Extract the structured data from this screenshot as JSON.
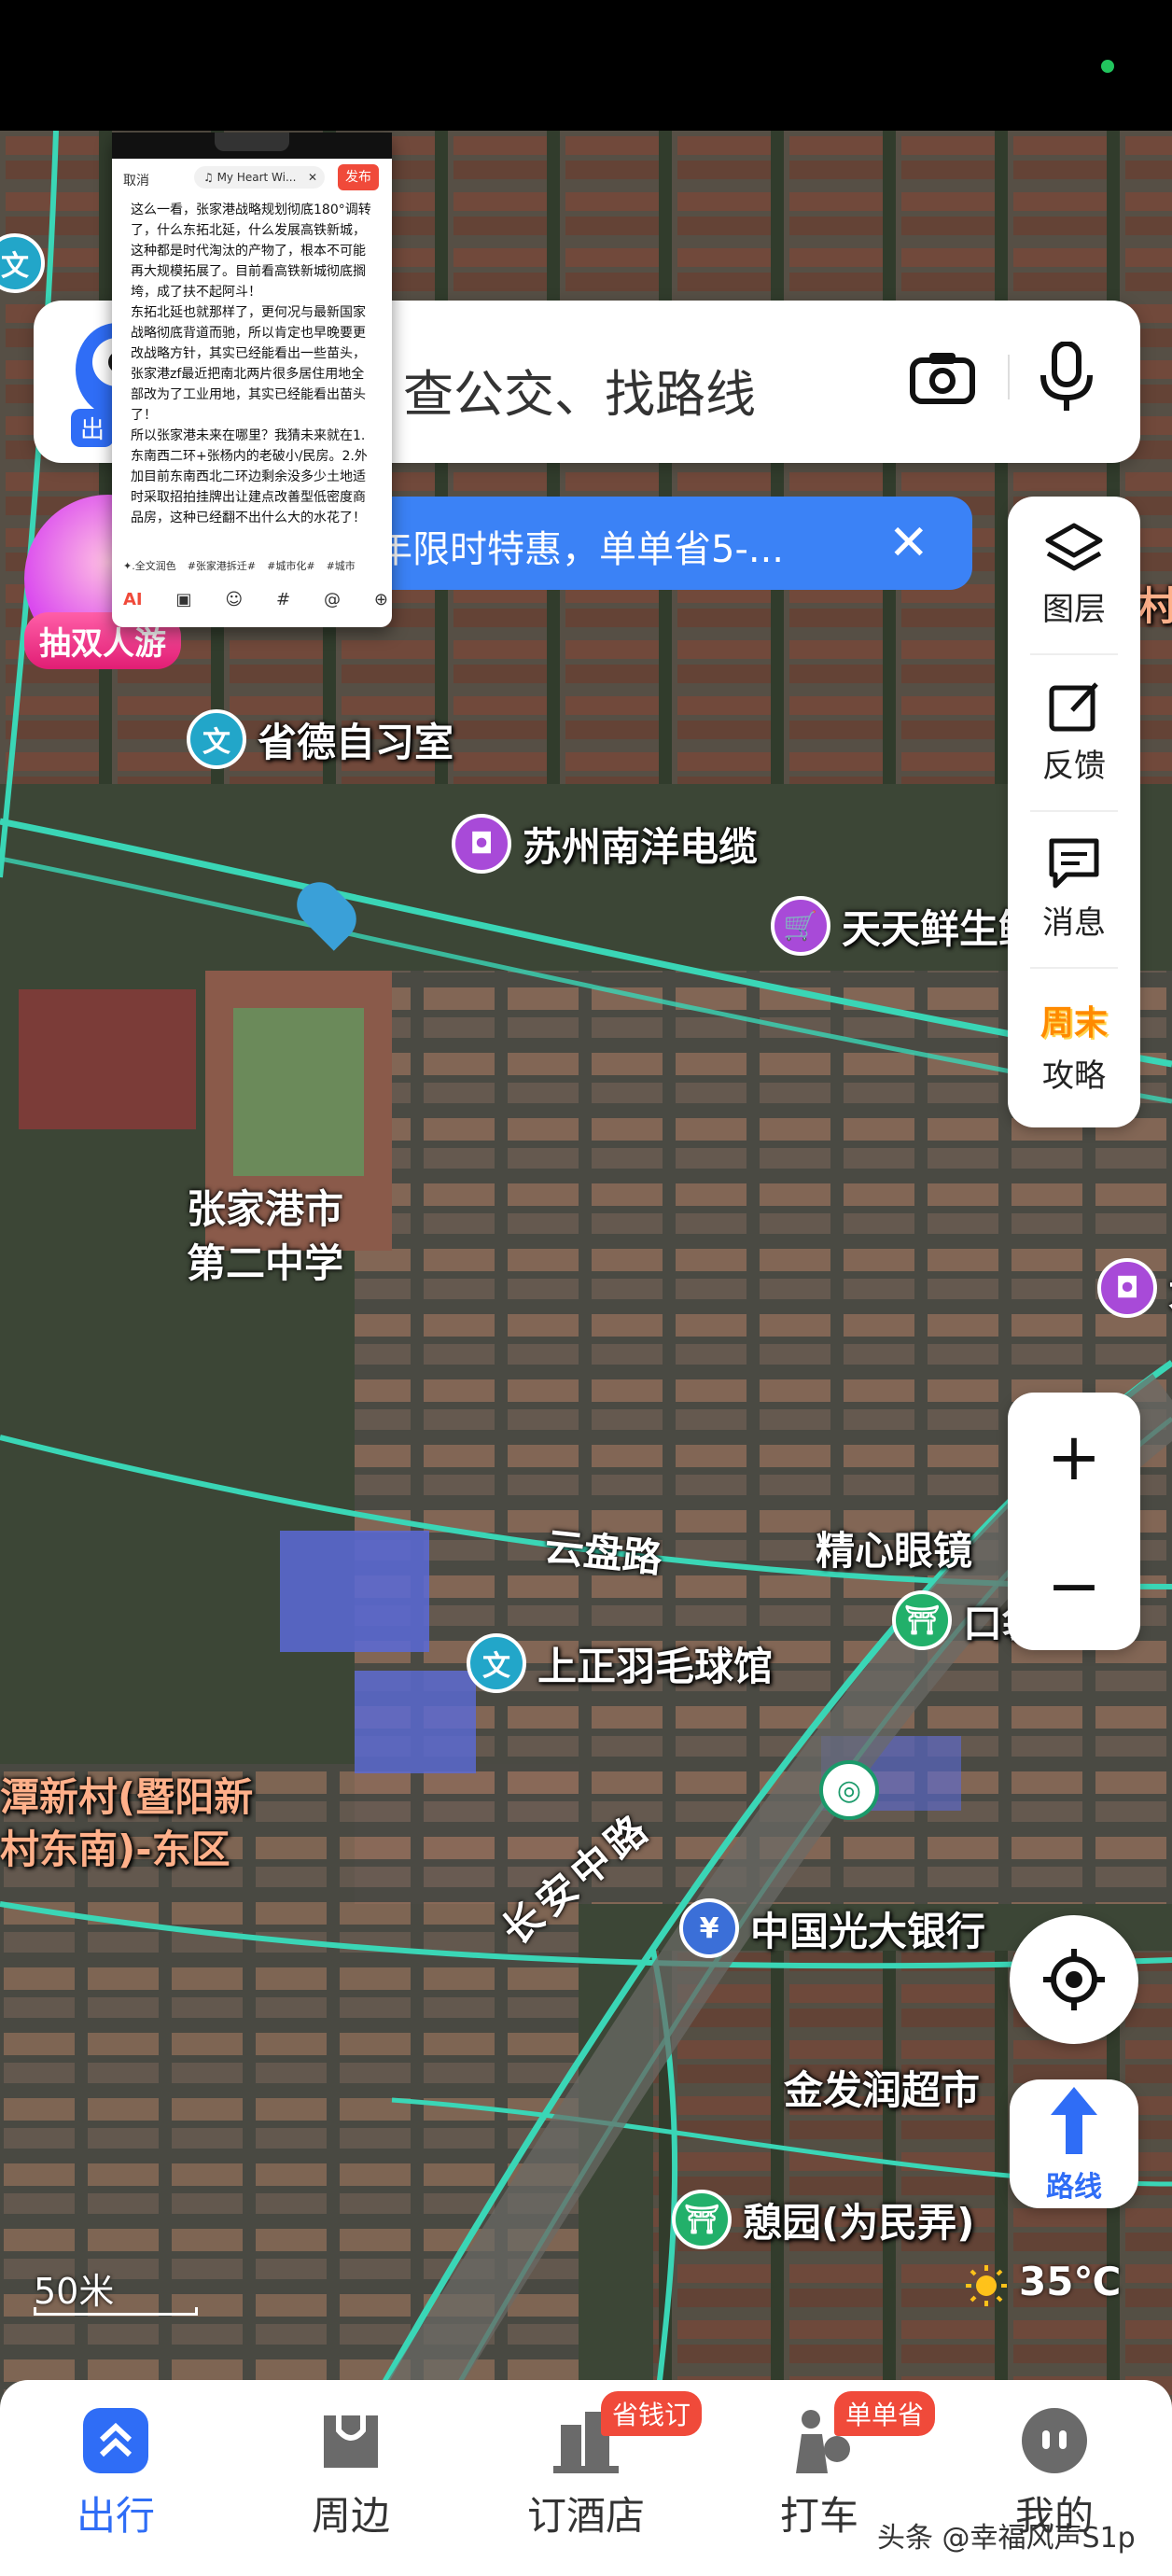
{
  "search": {
    "placeholder": "查公交、找路线",
    "mascot_tag": "出"
  },
  "promo": {
    "text": "年限时特惠，单单省5-...",
    "close": "✕"
  },
  "castle": {
    "tag": "抽双人游"
  },
  "right_panel": {
    "items": [
      {
        "label": "图层",
        "icon": "layers-icon"
      },
      {
        "label": "反馈",
        "icon": "feedback-icon"
      },
      {
        "label": "消息",
        "icon": "message-icon"
      },
      {
        "label": "攻略",
        "icon": "weekend-guide-icon",
        "badge": "周末"
      }
    ]
  },
  "zoom": {
    "in": "+",
    "out": "−"
  },
  "route": {
    "label": "路线"
  },
  "scale": {
    "label": "50米"
  },
  "weather": {
    "temp": "35℃"
  },
  "map": {
    "pois": [
      {
        "label": "省德自习室",
        "icon": "文"
      },
      {
        "label": "苏州南洋电缆",
        "icon": "shopping-bag-icon"
      },
      {
        "label": "天天鲜生鲜",
        "icon": "cart-icon"
      },
      {
        "label": "张家港市",
        "icon": ""
      },
      {
        "label": "第二中学",
        "icon": ""
      },
      {
        "label": "精心眼镜",
        "icon": ""
      },
      {
        "label": "上正羽毛球馆",
        "icon": "文"
      },
      {
        "label": "潭新村(暨阳新",
        "icon": ""
      },
      {
        "label": "村东南)-东区",
        "icon": ""
      },
      {
        "label": "中国光大银行",
        "icon": "bank-icon"
      },
      {
        "label": "金发润超市",
        "icon": ""
      },
      {
        "label": "憩园(为民弄)",
        "icon": "park-icon"
      },
      {
        "label": "口袋",
        "icon": ""
      },
      {
        "label": "村",
        "icon": ""
      },
      {
        "label": "大",
        "icon": ""
      },
      {
        "label": "文",
        "icon": ""
      }
    ],
    "roads": [
      "云盘路",
      "长安中路"
    ]
  },
  "tabbar": {
    "tabs": [
      {
        "label": "出行",
        "active": true
      },
      {
        "label": "周边",
        "active": false
      },
      {
        "label": "订酒店",
        "active": false,
        "badge": "省钱订"
      },
      {
        "label": "打车",
        "active": false,
        "badge": "单单省"
      },
      {
        "label": "我的",
        "active": false
      }
    ]
  },
  "watermark": "头条 @幸福风声S1p",
  "editor": {
    "cancel": "取消",
    "music": "♫ My Heart Wi...",
    "music_close": "✕",
    "publish": "发布",
    "body": [
      "这么一看，张家港战略规划彻底180°调转了，什么东拓北延，什么发展高铁新城，这种都是时代淘汰的产物了，根本不可能再大规模拓展了。目前看高铁新城彻底搁垮，成了扶不起阿斗！",
      "东拓北延也就那样了，更何况与最新国家战略彻底背道而驰，所以肯定也早晚要更改战略方针，其实已经能看出一些苗头，张家港zf最近把南北两片很多居住用地全部改为了工业用地，其实已经能看出苗头了！",
      "所以张家港未来在哪里？我猜未来就在1.东南西二环+张杨内的老破小/民房。2.外加目前东南西北二环边剩余没多少土地适时采取招拍挂牌出让建点改善型低密度商品房，这种已经翻不出什么大的水花了！"
    ],
    "tags": [
      "✦.全文润色",
      "#张家港拆迁#",
      "#城市化#",
      "#城市"
    ],
    "tools": [
      "AI",
      "image-icon",
      "emoji-icon",
      "#",
      "@",
      "plus-icon"
    ]
  }
}
